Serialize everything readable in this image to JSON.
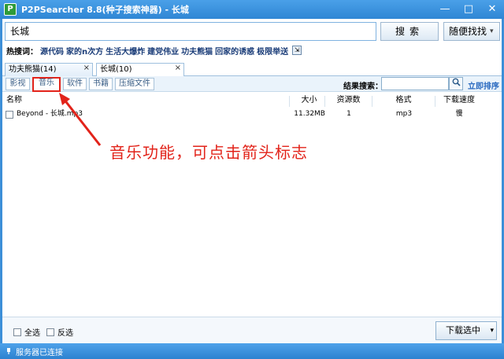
{
  "window": {
    "title": "P2PSearcher 8.8(种子搜索神器) - 长城",
    "logo_text": "P",
    "minimize": "—",
    "maximize": "□",
    "close": "✕"
  },
  "search": {
    "query": "长城",
    "search_label": "搜索",
    "random_label": "随便找找",
    "random_dropdown": "▾"
  },
  "hot": {
    "label": "热搜词：",
    "items": [
      "源代码",
      "家的n次方",
      "生活大爆炸",
      "建党伟业",
      "功夫熊猫",
      "回家的诱惑",
      "极限举送"
    ],
    "icon": "⇲"
  },
  "tabs": [
    {
      "label": "功夫熊猫(14)",
      "close": "×"
    },
    {
      "label": "长城(10)",
      "close": "×"
    }
  ],
  "categories": [
    "影视",
    "音乐",
    "软件",
    "书籍",
    "压缩文件"
  ],
  "filter": {
    "result_label": "结果搜索：",
    "result_value": "",
    "search_icon": "🔍",
    "sort_label": "立即排序"
  },
  "table": {
    "headers": [
      "名称",
      "大小",
      "资源数",
      "格式",
      "下载速度"
    ],
    "rows": [
      {
        "name": "Beyond - 长城.mp3",
        "size": "11.32MB",
        "count": "1",
        "format": "mp3",
        "speed": "慢"
      }
    ]
  },
  "annotation": {
    "text": "音乐功能，可点击箭头标志",
    "color": "#e2231a"
  },
  "footer": {
    "select_all": "全选",
    "inverse": "反选",
    "download": "下载选中",
    "download_dropdown": "▾"
  },
  "status": {
    "icon": "plug-icon",
    "text": "服务器已连接"
  },
  "colors": {
    "titlebar": "#3d8fd8",
    "accent_red": "#e2231a",
    "link_blue": "#2a6ac0"
  }
}
